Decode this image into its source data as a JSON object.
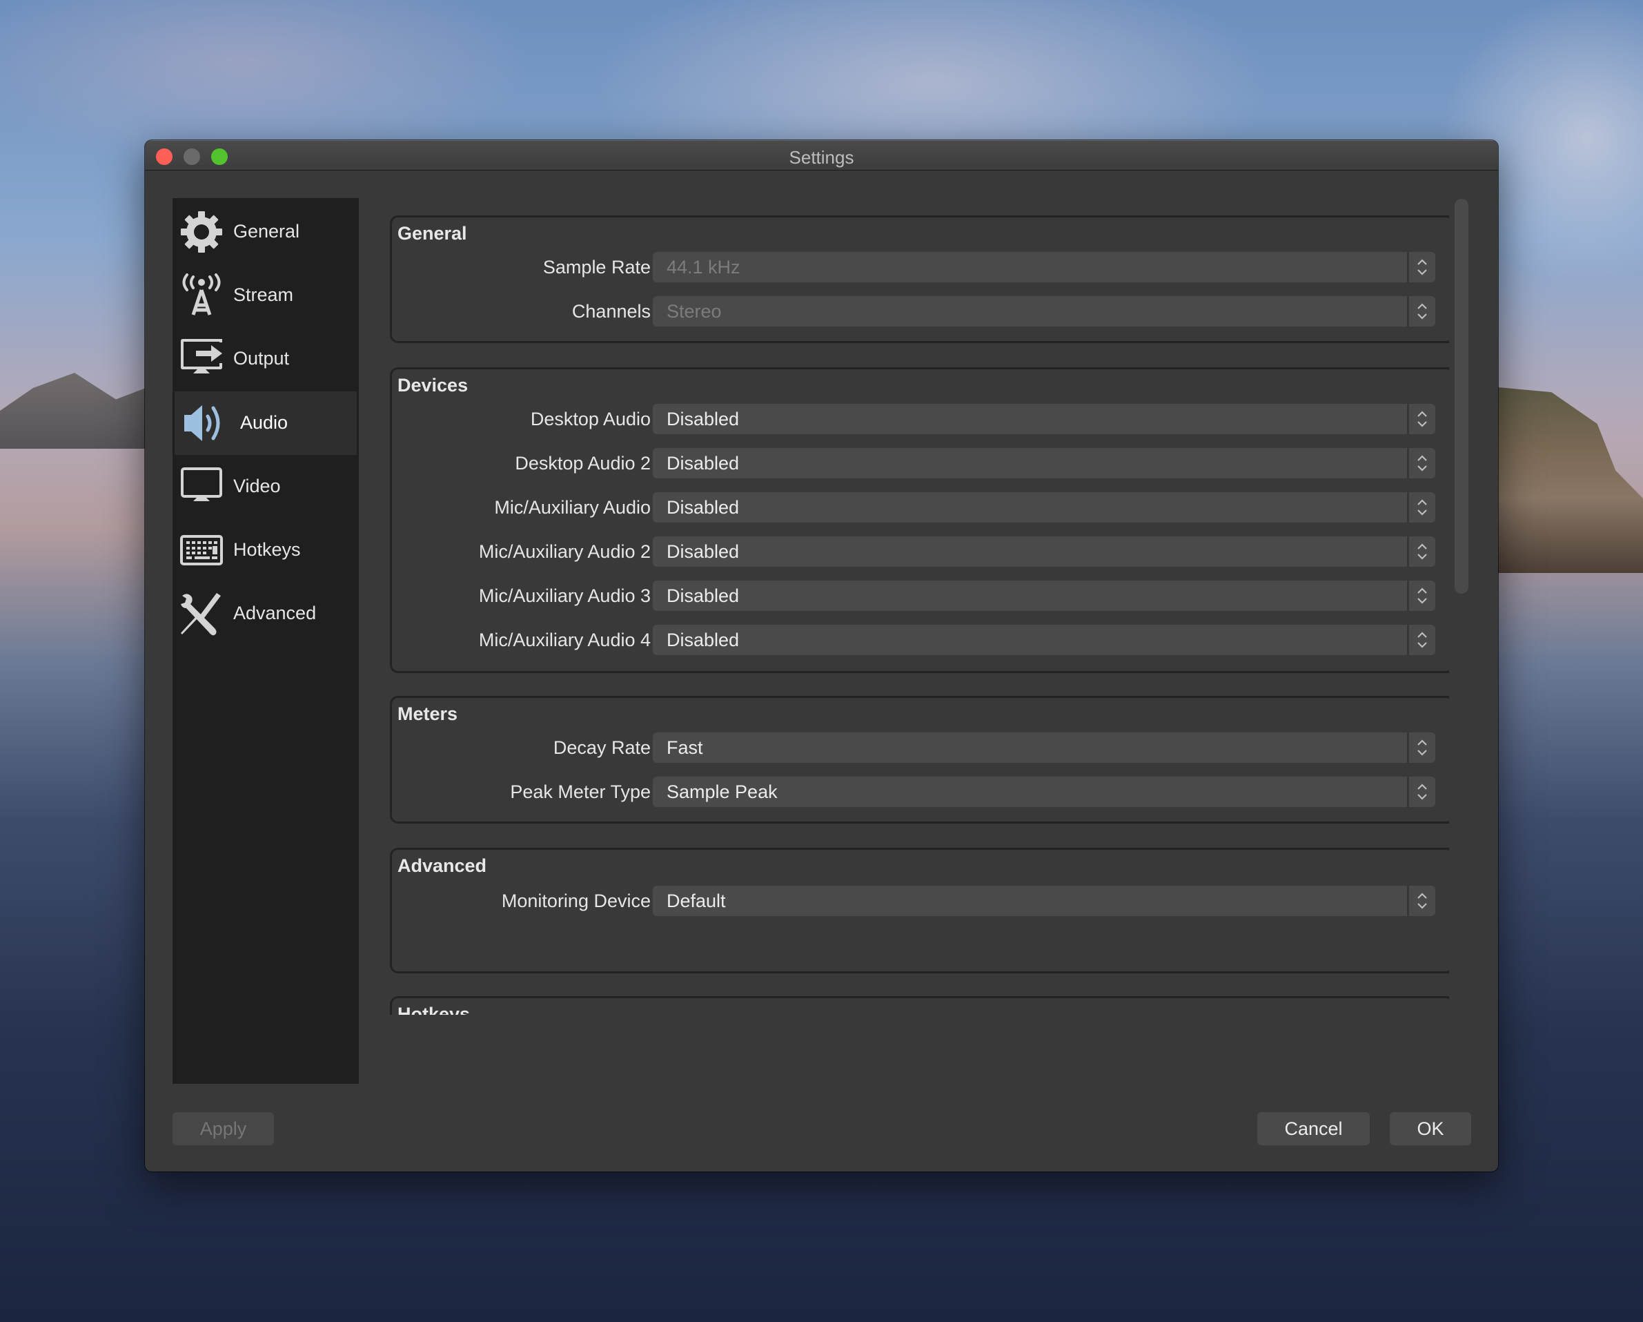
{
  "window": {
    "title": "Settings",
    "controls": [
      "close",
      "minimize",
      "maximize"
    ]
  },
  "sidebar": {
    "selected": "Audio",
    "items": [
      {
        "label": "General",
        "icon": "gear-icon"
      },
      {
        "label": "Stream",
        "icon": "broadcast-tower-icon"
      },
      {
        "label": "Output",
        "icon": "monitor-output-icon"
      },
      {
        "label": "Audio",
        "icon": "speaker-icon"
      },
      {
        "label": "Video",
        "icon": "monitor-icon"
      },
      {
        "label": "Hotkeys",
        "icon": "keyboard-icon"
      },
      {
        "label": "Advanced",
        "icon": "tools-icon"
      }
    ]
  },
  "sections": {
    "general": {
      "title": "General",
      "rows": [
        {
          "label": "Sample Rate",
          "value": "44.1 kHz",
          "enabled": false
        },
        {
          "label": "Channels",
          "value": "Stereo",
          "enabled": false
        }
      ]
    },
    "devices": {
      "title": "Devices",
      "rows": [
        {
          "label": "Desktop Audio",
          "value": "Disabled"
        },
        {
          "label": "Desktop Audio 2",
          "value": "Disabled"
        },
        {
          "label": "Mic/Auxiliary Audio",
          "value": "Disabled"
        },
        {
          "label": "Mic/Auxiliary Audio 2",
          "value": "Disabled"
        },
        {
          "label": "Mic/Auxiliary Audio 3",
          "value": "Disabled"
        },
        {
          "label": "Mic/Auxiliary Audio 4",
          "value": "Disabled"
        }
      ]
    },
    "meters": {
      "title": "Meters",
      "rows": [
        {
          "label": "Decay Rate",
          "value": "Fast"
        },
        {
          "label": "Peak Meter Type",
          "value": "Sample Peak"
        }
      ]
    },
    "advanced": {
      "title": "Advanced",
      "rows": [
        {
          "label": "Monitoring Device",
          "value": "Default"
        }
      ]
    },
    "hotkeys": {
      "title": "Hotkeys"
    }
  },
  "buttons": {
    "apply": "Apply",
    "cancel": "Cancel",
    "ok": "OK"
  },
  "colors": {
    "selected_icon": "#9dbfe0",
    "icon": "#d4d4d4"
  }
}
